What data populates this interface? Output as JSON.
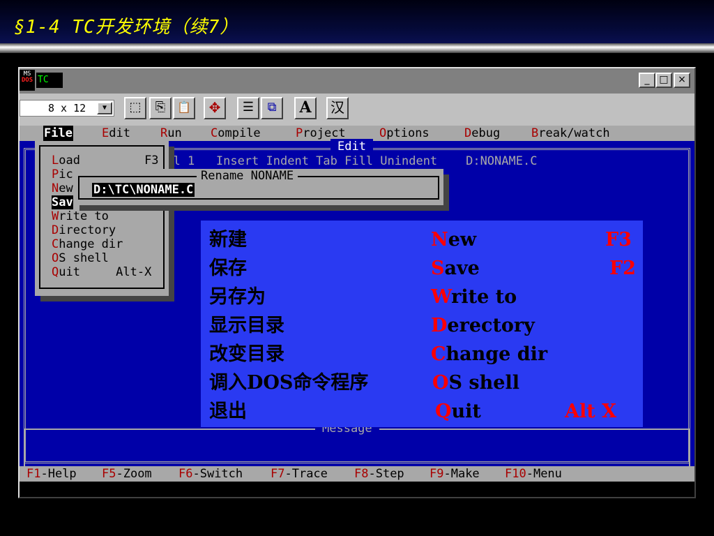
{
  "slide": {
    "title": "§1-4 TC开发环境（续7）"
  },
  "window": {
    "icon_top": "MS",
    "icon_bottom": "DOS",
    "title": "TC",
    "controls": {
      "minimize": "_",
      "maximize": "□",
      "close": "×"
    }
  },
  "toolbar": {
    "font_size": "8 x 12",
    "font_dropdown": "▼",
    "buttons": [
      {
        "icon": "mark-icon",
        "glyph": "⬚"
      },
      {
        "icon": "copy-icon",
        "glyph": "⎘"
      },
      {
        "icon": "paste-icon",
        "glyph": "📋"
      },
      {
        "icon": "fullscreen-icon",
        "glyph": "✥"
      },
      {
        "icon": "properties-icon",
        "glyph": "☰"
      },
      {
        "icon": "background-icon",
        "glyph": "⧉"
      },
      {
        "icon": "font-icon",
        "glyph": "A"
      },
      {
        "icon": "chinese-input-icon",
        "glyph": "汉"
      }
    ]
  },
  "menubar": {
    "items": [
      {
        "hotkey": "F",
        "rest": "ile",
        "active": true
      },
      {
        "hotkey": "E",
        "rest": "dit"
      },
      {
        "hotkey": "R",
        "rest": "un"
      },
      {
        "hotkey": "C",
        "rest": "ompile"
      },
      {
        "hotkey": "P",
        "rest": "roject"
      },
      {
        "hotkey": "O",
        "rest": "ptions"
      },
      {
        "hotkey": "D",
        "rest": "ebug"
      },
      {
        "hotkey": "B",
        "rest": "reak/watch"
      }
    ]
  },
  "editor": {
    "title": "Edit",
    "status": "Col 1   Insert Indent Tab Fill Unindent    D:NONAME.C"
  },
  "file_menu": {
    "items": [
      {
        "hotkey": "L",
        "rest": "oad         F3"
      },
      {
        "hotkey": "P",
        "rest": "ic"
      },
      {
        "hotkey": "N",
        "rest": "ew"
      },
      {
        "hotkey": "",
        "rest": "Sav",
        "selected": true
      },
      {
        "hotkey": "W",
        "rest": "rite to"
      },
      {
        "hotkey": "D",
        "rest": "irectory"
      },
      {
        "hotkey": "C",
        "rest": "hange dir"
      },
      {
        "hotkey": "O",
        "rest": "S shell"
      },
      {
        "hotkey": "Q",
        "rest": "uit     Alt-X"
      }
    ]
  },
  "rename_dialog": {
    "title": "Rename NONAME",
    "value": "D:\\TC\\NONAME.C"
  },
  "message": {
    "title": "Message"
  },
  "function_bar": {
    "items": [
      {
        "key": "F1",
        "label": "-Help"
      },
      {
        "key": "F5",
        "label": "-Zoom"
      },
      {
        "key": "F6",
        "label": "-Switch"
      },
      {
        "key": "F7",
        "label": "-Trace"
      },
      {
        "key": "F8",
        "label": "-Step"
      },
      {
        "key": "F9",
        "label": "-Make"
      },
      {
        "key": "F10",
        "label": "-Menu"
      }
    ]
  },
  "overlay": {
    "rows": [
      {
        "cn": "新建",
        "en_first": "N",
        "en_rest": "ew",
        "key": "F3"
      },
      {
        "cn": "保存",
        "en_first": "S",
        "en_rest": "ave",
        "key": "F2"
      },
      {
        "cn": "另存为",
        "en_first": "W",
        "en_rest": "rite  to",
        "key": ""
      },
      {
        "cn": "显示目录",
        "en_first": "D",
        "en_rest": "erectory",
        "key": ""
      },
      {
        "cn": "改变目录",
        "en_first": "C",
        "en_rest": "hange  dir",
        "key": ""
      },
      {
        "cn": "调入DOS命令程序",
        "en_first": "O",
        "en_rest": "S  shell",
        "key": ""
      },
      {
        "cn": "退出",
        "en_first": "Q",
        "en_rest": "uit",
        "key": "Alt  X"
      }
    ]
  },
  "colors": {
    "dos_blue": "#0000a8",
    "dos_gray": "#a8a8a8",
    "hotkey_red": "#a80000",
    "overlay_blue": "#2a3af2",
    "overlay_red": "#ff0000",
    "title_yellow": "#ffff00"
  }
}
